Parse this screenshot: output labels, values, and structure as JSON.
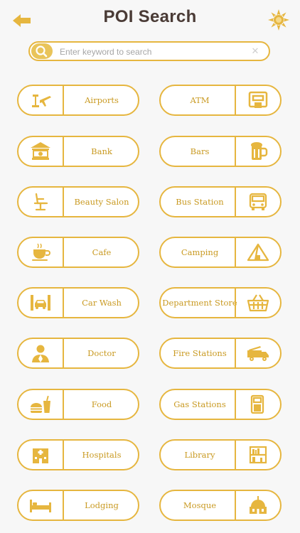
{
  "header": {
    "title": "POI Search"
  },
  "search": {
    "placeholder": "Enter keyword to search"
  },
  "categories": [
    {
      "label": "Airports",
      "icon": "airport-icon"
    },
    {
      "label": "ATM",
      "icon": "atm-icon"
    },
    {
      "label": "Bank",
      "icon": "bank-icon"
    },
    {
      "label": "Bars",
      "icon": "beer-icon"
    },
    {
      "label": "Beauty Salon",
      "icon": "salon-chair-icon"
    },
    {
      "label": "Bus Station",
      "icon": "bus-icon"
    },
    {
      "label": "Cafe",
      "icon": "coffee-cup-icon"
    },
    {
      "label": "Camping",
      "icon": "tent-icon"
    },
    {
      "label": "Car Wash",
      "icon": "car-wash-icon"
    },
    {
      "label": "Department Store",
      "icon": "basket-icon"
    },
    {
      "label": "Doctor",
      "icon": "doctor-icon"
    },
    {
      "label": "Fire Stations",
      "icon": "fire-truck-icon"
    },
    {
      "label": "Food",
      "icon": "burger-drink-icon"
    },
    {
      "label": "Gas Stations",
      "icon": "gas-pump-icon"
    },
    {
      "label": "Hospitals",
      "icon": "hospital-icon"
    },
    {
      "label": "Library",
      "icon": "bookshelf-icon"
    },
    {
      "label": "Lodging",
      "icon": "bed-icon"
    },
    {
      "label": "Mosque",
      "icon": "mosque-icon"
    }
  ],
  "colors": {
    "accent": "#e6b63f",
    "label": "#c99a22",
    "title": "#4a3b36"
  }
}
